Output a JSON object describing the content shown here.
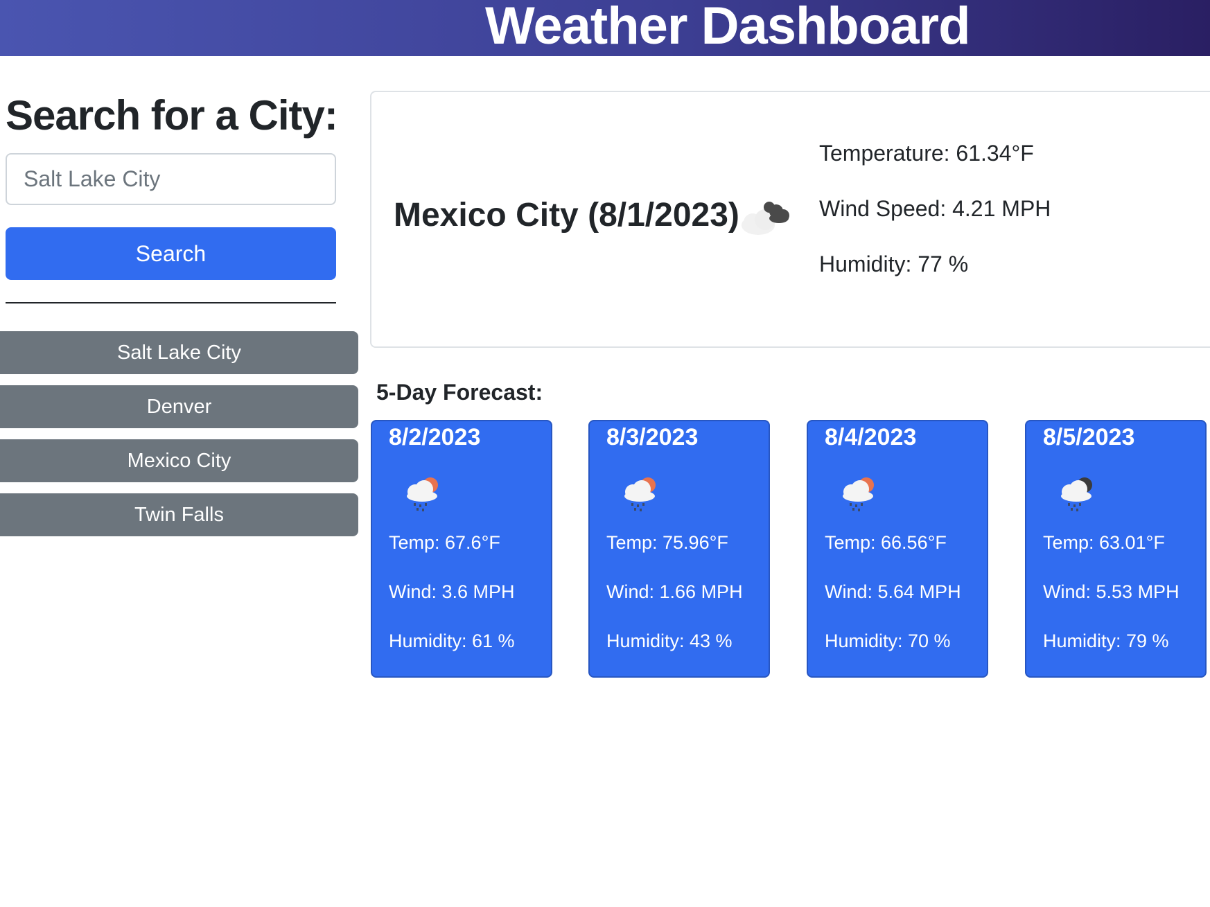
{
  "header": {
    "title": "Weather Dashboard"
  },
  "search": {
    "heading": "Search for a City:",
    "placeholder": "Salt Lake City",
    "button_label": "Search"
  },
  "history": [
    {
      "label": "Salt Lake City"
    },
    {
      "label": "Denver"
    },
    {
      "label": "Mexico City"
    },
    {
      "label": "Twin Falls"
    }
  ],
  "current": {
    "title": "Mexico City (8/1/2023)",
    "icon": "broken-clouds-icon",
    "temperature": "Temperature: 61.34°F",
    "wind": "Wind Speed: 4.21 MPH",
    "humidity": "Humidity: 77 %"
  },
  "forecast": {
    "heading": "5-Day Forecast:",
    "days": [
      {
        "date": "8/2/2023",
        "icon": "rain-day-icon",
        "temp": "Temp: 67.6°F",
        "wind": "Wind: 3.6 MPH",
        "humidity": "Humidity: 61 %"
      },
      {
        "date": "8/3/2023",
        "icon": "rain-day-icon",
        "temp": "Temp: 75.96°F",
        "wind": "Wind: 1.66 MPH",
        "humidity": "Humidity: 43 %"
      },
      {
        "date": "8/4/2023",
        "icon": "rain-day-icon",
        "temp": "Temp: 66.56°F",
        "wind": "Wind: 5.64 MPH",
        "humidity": "Humidity: 70 %"
      },
      {
        "date": "8/5/2023",
        "icon": "rain-night-icon",
        "temp": "Temp: 63.01°F",
        "wind": "Wind: 5.53 MPH",
        "humidity": "Humidity: 79 %"
      }
    ]
  },
  "colors": {
    "header_start": "#4a55b0",
    "header_end": "#2a1f63",
    "primary": "#316cf0",
    "secondary": "#6c757d"
  }
}
